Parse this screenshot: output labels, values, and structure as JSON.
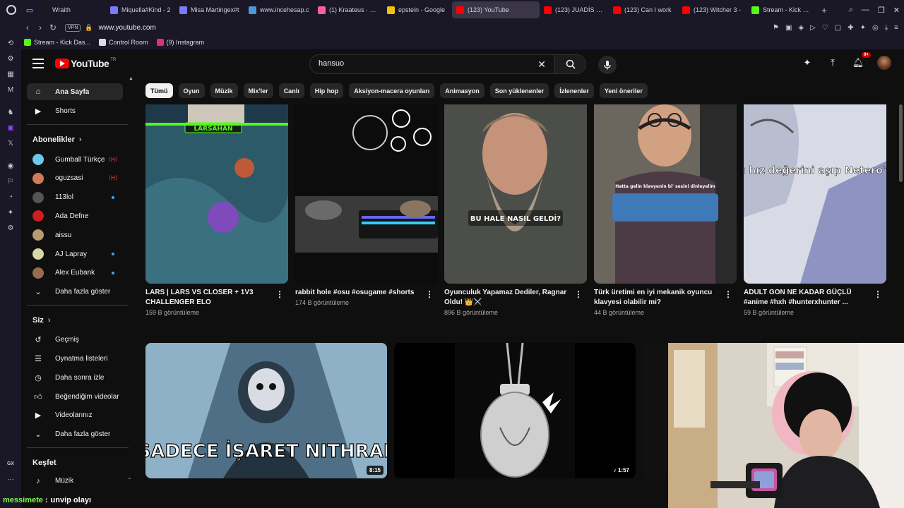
{
  "browser": {
    "tabs": [
      {
        "title": "Wraith",
        "color": "#1b1b1b",
        "active": false
      },
      {
        "title": "Miquella#Kind - 2",
        "color": "#7b7bff",
        "active": false
      },
      {
        "title": "Misa Martingex#t",
        "color": "#7b7bff",
        "active": false
      },
      {
        "title": "www.incehesap.c",
        "color": "#4a9ad8",
        "active": false
      },
      {
        "title": "(1) Kraateus · oyu",
        "color": "#ff5fa0",
        "active": false
      },
      {
        "title": "epstein - Google",
        "color": "#f4c20d",
        "active": false
      },
      {
        "title": "(123) YouTube",
        "color": "#ff0000",
        "active": true
      },
      {
        "title": "(123) JUADİS HA",
        "color": "#ff0000",
        "active": false
      },
      {
        "title": "(123) Can I work",
        "color": "#ff0000",
        "active": false
      },
      {
        "title": "(123) Witcher 3 -",
        "color": "#ff0000",
        "active": false
      },
      {
        "title": "Stream - Kick Das",
        "color": "#53fc18",
        "active": false
      }
    ],
    "new_tab": "+",
    "vpn_label": "VPN",
    "url": "www.youtube.com",
    "bookmarks": [
      {
        "label": "Stream - Kick Das...",
        "color": "#53fc18"
      },
      {
        "label": "Control Room",
        "color": "#dddddd"
      },
      {
        "label": "(9) Instagram",
        "color": "#e1306c"
      }
    ],
    "gx_label": "GX"
  },
  "youtube": {
    "logo_text": "YouTube",
    "country": "TR",
    "search_value": "hansuo",
    "notifications_badge": "9+",
    "sidebar": {
      "main": [
        {
          "label": "Ana Sayfa",
          "icon": "home-icon",
          "active": true
        },
        {
          "label": "Shorts",
          "icon": "shorts-icon",
          "active": false
        }
      ],
      "subs_header": "Abonelikler",
      "subs": [
        {
          "label": "Gumball Türkçe",
          "avatar": "#6ec6e8",
          "status": "live"
        },
        {
          "label": "oguzsasi",
          "avatar": "#d07a5a",
          "status": "live"
        },
        {
          "label": "113lol",
          "avatar": "#555555",
          "status": "new"
        },
        {
          "label": "Ada Defne",
          "avatar": "#cc2020",
          "status": "none"
        },
        {
          "label": "aissu",
          "avatar": "#b89a70",
          "status": "none"
        },
        {
          "label": "AJ Lapray",
          "avatar": "#d6d6a8",
          "status": "new"
        },
        {
          "label": "Alex Eubank",
          "avatar": "#9a6a50",
          "status": "new"
        }
      ],
      "show_more": "Daha fazla göster",
      "you_header": "Siz",
      "you": [
        {
          "label": "Geçmiş",
          "icon": "history-icon"
        },
        {
          "label": "Oynatma listeleri",
          "icon": "playlists-icon"
        },
        {
          "label": "Daha sonra izle",
          "icon": "watch-later-icon"
        },
        {
          "label": "Beğendiğim videolar",
          "icon": "like-icon"
        },
        {
          "label": "Videolarınız",
          "icon": "your-videos-icon"
        }
      ],
      "show_more2": "Daha fazla göster",
      "explore_header": "Keşfet",
      "explore": [
        {
          "label": "Müzik",
          "icon": "music-icon"
        }
      ]
    },
    "chips": [
      "Tümü",
      "Oyun",
      "Müzik",
      "Mix'ler",
      "Canlı",
      "Hip hop",
      "Aksiyon-macera oyunları",
      "Animasyon",
      "Son yüklenenler",
      "İzlenenler",
      "Yeni öneriler"
    ],
    "shorts": [
      {
        "title": "LARS | LARS VS CLOSER + 1V3 CHALLENGER ELO",
        "views": "159 B görüntüleme",
        "overlay": "LARSAHAN"
      },
      {
        "title": "rabbit hole #osu #osugame #shorts",
        "views": "174 B görüntüleme",
        "overlay": ""
      },
      {
        "title": "Oyunculuk Yapamaz Dediler, Ragnar Oldu! 👑⚔️",
        "views": "896 B görüntüleme",
        "overlay": "BU HALE NASIL GELDİ?"
      },
      {
        "title": "Türk üretimi en iyi mekanik oyuncu klavyesi olabilir mi?",
        "views": "44 B görüntüleme",
        "overlay": "Hatta gelin klavyenin bi' sesini dinleyelim"
      },
      {
        "title": "ADULT GON NE KADAR GÜÇLÜ #anime #hxh #hunterxhunter ...",
        "views": "59 B görüntüleme",
        "overlay": "bu hız değerini aşıp Netero'ya"
      }
    ],
    "videos": [
      {
        "overlay": "SADECE İŞARET NITHRAL",
        "duration": "8:15"
      },
      {
        "overlay": "",
        "duration": "♪ 1:57"
      }
    ]
  },
  "chat": {
    "user": "messimete",
    "separator": ":",
    "message": "unvip olayı"
  }
}
